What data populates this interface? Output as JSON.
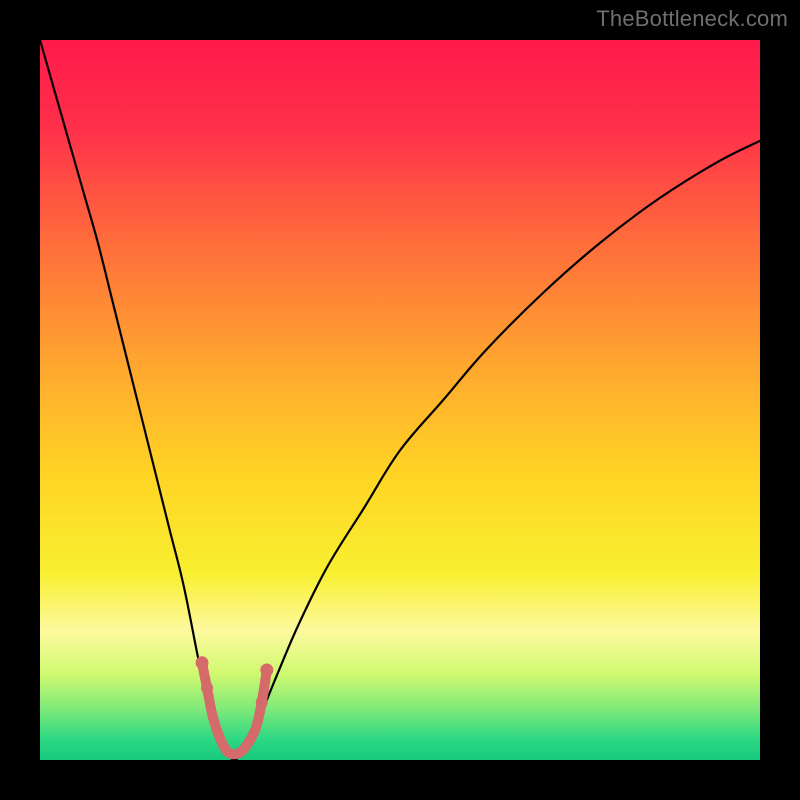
{
  "watermark": "TheBottleneck.com",
  "chart_data": {
    "type": "line",
    "title": "",
    "xlabel": "",
    "ylabel": "",
    "xlim": [
      0,
      100
    ],
    "ylim": [
      0,
      100
    ],
    "grid": false,
    "legend": null,
    "background_gradient_stops": [
      {
        "offset": 0.0,
        "color": "#ff1a4b"
      },
      {
        "offset": 0.12,
        "color": "#ff2f4a"
      },
      {
        "offset": 0.28,
        "color": "#ff6c3b"
      },
      {
        "offset": 0.45,
        "color": "#ffa62f"
      },
      {
        "offset": 0.6,
        "color": "#ffd324"
      },
      {
        "offset": 0.74,
        "color": "#f8ef2f"
      },
      {
        "offset": 0.82,
        "color": "#fdf99e"
      },
      {
        "offset": 0.88,
        "color": "#d0f96f"
      },
      {
        "offset": 0.93,
        "color": "#7de979"
      },
      {
        "offset": 0.97,
        "color": "#2fd884"
      },
      {
        "offset": 1.0,
        "color": "#16c97c"
      }
    ],
    "optimal_x": 27,
    "series": [
      {
        "name": "bottleneck-curve",
        "color": "#000000",
        "x": [
          0,
          2,
          4,
          6,
          8,
          10,
          12,
          14,
          16,
          18,
          20,
          22,
          23,
          24,
          25,
          26,
          27,
          28,
          29,
          30,
          31,
          33,
          36,
          40,
          45,
          50,
          56,
          62,
          70,
          78,
          86,
          94,
          100
        ],
        "values": [
          100,
          93,
          86,
          79,
          72,
          64,
          56,
          48,
          40,
          32,
          24,
          14,
          10,
          6,
          3,
          1,
          0,
          1,
          2,
          4,
          7,
          12,
          19,
          27,
          35,
          43,
          50,
          57,
          65,
          72,
          78,
          83,
          86
        ]
      },
      {
        "name": "sweet-spot-band",
        "color": "#d46a6a",
        "type": "marker-band",
        "x": [
          22.5,
          23.2,
          24.0,
          25.0,
          26.0,
          27.0,
          28.0,
          29.0,
          30.0,
          30.8,
          31.5
        ],
        "values": [
          13.5,
          10.0,
          6.0,
          3.0,
          1.2,
          0.8,
          1.2,
          2.5,
          4.5,
          8.0,
          12.5
        ]
      }
    ]
  }
}
